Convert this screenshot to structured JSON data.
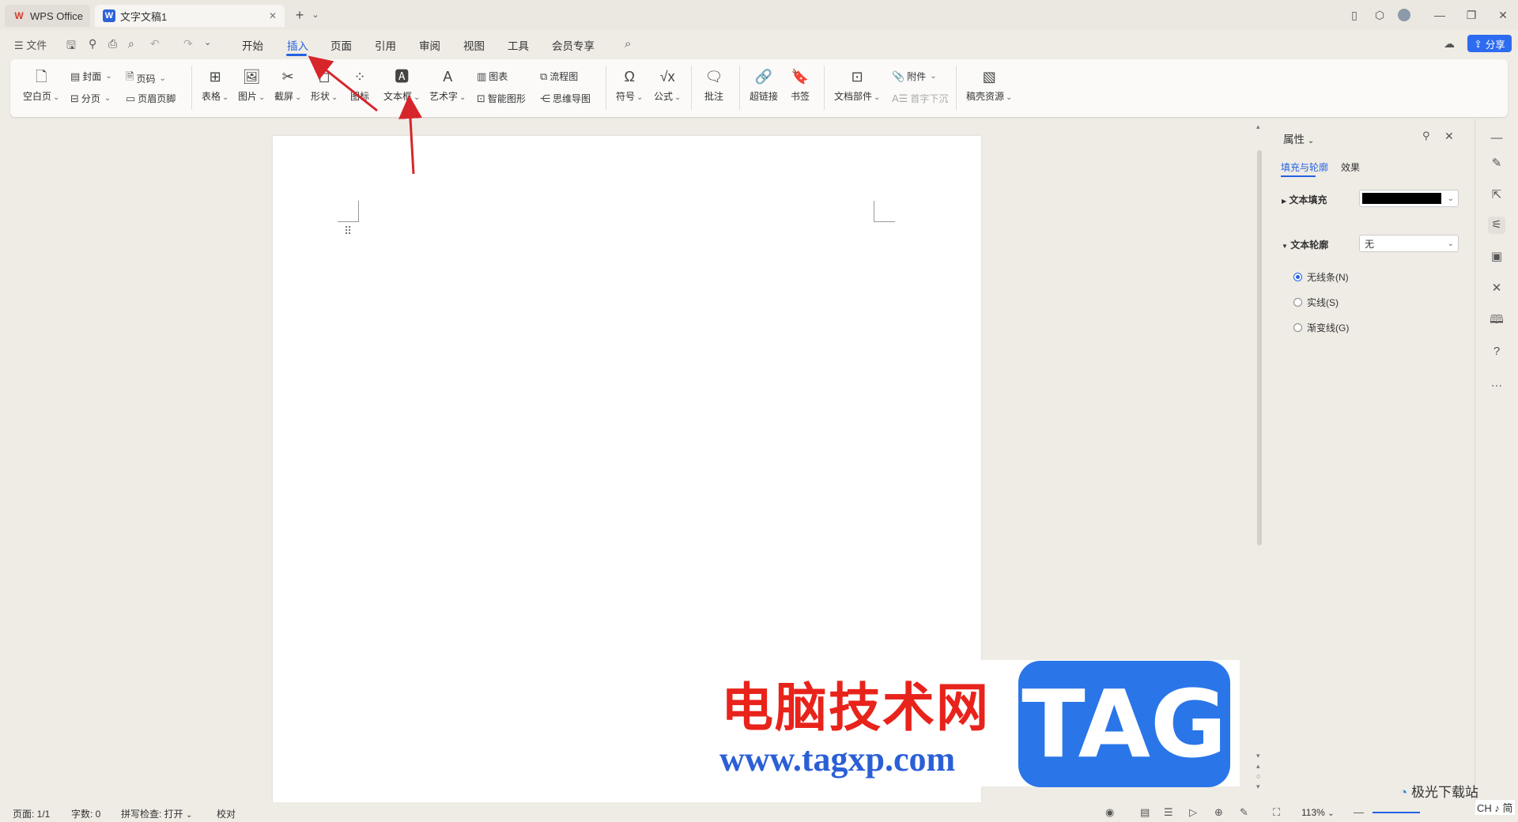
{
  "window": {
    "tabs": [
      {
        "label": "WPS Office"
      },
      {
        "label": "文字文稿1"
      }
    ],
    "new_tab": "+"
  },
  "menu": {
    "file": "文件",
    "items": [
      "开始",
      "插入",
      "页面",
      "引用",
      "审阅",
      "视图",
      "工具",
      "会员专享"
    ],
    "active": "插入",
    "share": "分享"
  },
  "ribbon": {
    "blank_page": "空白页",
    "cover": "封面",
    "page_break": "分页",
    "page_number": "页码",
    "header_footer": "页眉页脚",
    "table": "表格",
    "picture": "图片",
    "screenshot": "截屏",
    "shape": "形状",
    "icon": "图标",
    "textbox": "文本框",
    "wordart": "艺术字",
    "chart": "图表",
    "smartart": "智能图形",
    "flowchart": "流程图",
    "mindmap": "思维导图",
    "symbol": "符号",
    "formula": "公式",
    "comment": "批注",
    "hyperlink": "超链接",
    "bookmark": "书签",
    "doc_parts": "文档部件",
    "attachment": "附件",
    "dropcap": "首字下沉",
    "resources": "稿壳资源"
  },
  "props": {
    "title": "属性",
    "tabs": [
      "填充与轮廓",
      "效果"
    ],
    "fill_label": "文本填充",
    "fill_color": "#000000",
    "outline_label": "文本轮廓",
    "outline_value": "无",
    "radios": [
      "无线条(N)",
      "实线(S)",
      "渐变线(G)"
    ],
    "radio_selected": "无线条(N)"
  },
  "status": {
    "page": "页面: 1/1",
    "words": "字数: 0",
    "spell": "拼写检查: 打开",
    "proof": "校对",
    "zoom": "113%"
  },
  "watermark": {
    "cn": "电脑技术网",
    "url": "www.tagxp.com",
    "tag": "TAG",
    "site": "极光下载站",
    "ime": "CH ♪ 简"
  },
  "colors": {
    "accent": "#2462e3",
    "annotation_arrow": "#d6262b"
  }
}
